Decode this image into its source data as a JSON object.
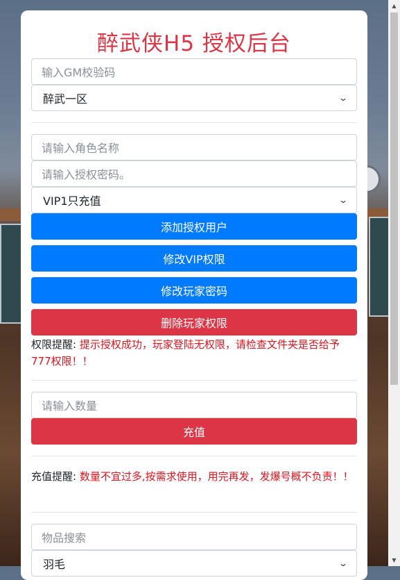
{
  "title": "醉武侠H5 授权后台",
  "gm_code": {
    "placeholder": "输入GM校验码"
  },
  "server_select": {
    "value": "醉武一区"
  },
  "role_name": {
    "placeholder": "请输入角色名称"
  },
  "auth_password": {
    "placeholder": "请输入授权密码。"
  },
  "vip_select": {
    "value": "VIP1只充值"
  },
  "buttons": {
    "add_user": "添加授权用户",
    "modify_vip": "修改VIP权限",
    "modify_password": "修改玩家密码",
    "delete_permission": "删除玩家权限",
    "recharge": "充值"
  },
  "permission_notice": {
    "label": "权限提醒:",
    "message": " 提示授权成功，玩家登陆无权限，请检查文件夹是否给予777权限！！"
  },
  "quantity": {
    "placeholder": "请输入数量"
  },
  "recharge_notice": {
    "label": "充值提醒:",
    "message": " 数量不宜过多,按需求使用，用完再发，发爆号概不负责！！"
  },
  "item_search": {
    "placeholder": "物品搜索"
  },
  "item_select": {
    "value": "羽毛"
  },
  "colors": {
    "primary": "#007bff",
    "danger": "#dc3545",
    "title": "#dc3545"
  },
  "icons": {
    "dropdown": "chevron-down-icon",
    "scroll_up": "scroll-up-arrow-icon",
    "scroll_down": "scroll-down-arrow-icon"
  }
}
